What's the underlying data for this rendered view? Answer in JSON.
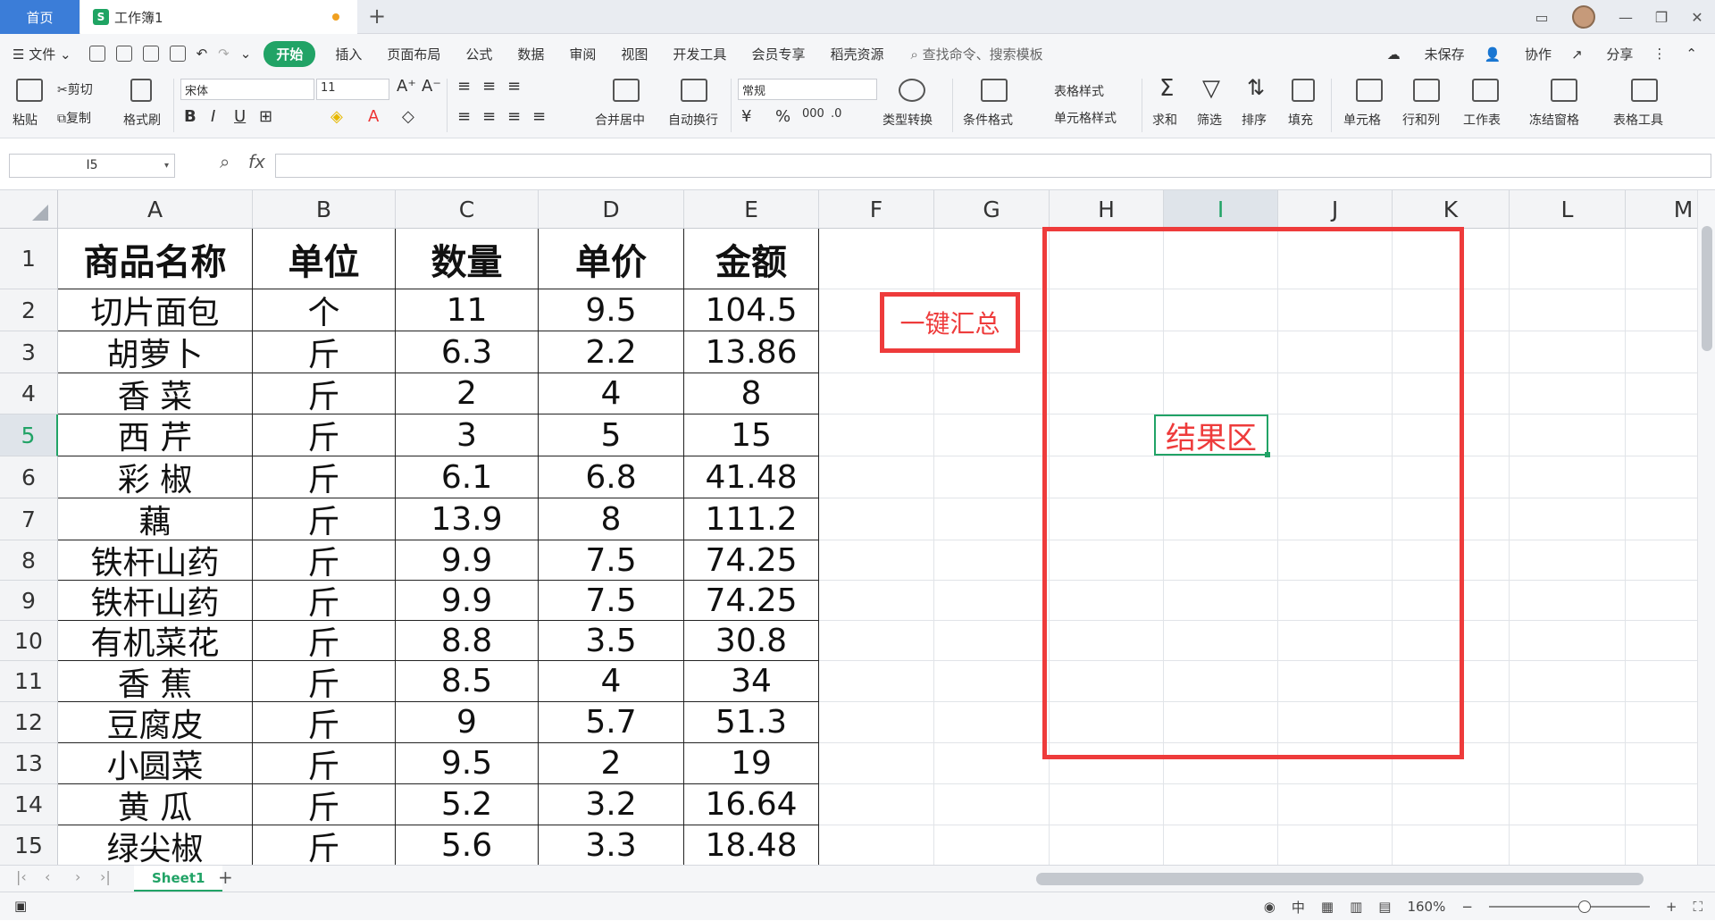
{
  "tabs": {
    "home": "首页",
    "doc": "工作簿1"
  },
  "menu": {
    "file": "文件",
    "items": [
      "开始",
      "插入",
      "页面布局",
      "公式",
      "数据",
      "审阅",
      "视图",
      "开发工具",
      "会员专享",
      "稻壳资源"
    ],
    "search": "查找命令、搜索模板",
    "right": [
      "未保存",
      "协作",
      "分享"
    ]
  },
  "ribbon": {
    "paste": "粘贴",
    "cut": "剪切",
    "copy": "复制",
    "format_painter": "格式刷",
    "font": "宋体",
    "size": "11",
    "merge": "合并居中",
    "wrap": "自动换行",
    "number_format": "常规",
    "convert": "类型转换",
    "cond_format": "条件格式",
    "table_style": "表格样式",
    "cell_style": "单元格样式",
    "sum": "求和",
    "filter": "筛选",
    "sort": "排序",
    "fill": "填充",
    "cell": "单元格",
    "rowcol": "行和列",
    "sheet": "工作表",
    "freeze": "冻结窗格",
    "tools": "表格工具"
  },
  "formula_bar": {
    "name_box": "I5",
    "fx": "fx",
    "value": ""
  },
  "columns": [
    "A",
    "B",
    "C",
    "D",
    "E",
    "F",
    "G",
    "H",
    "I",
    "J",
    "K",
    "L",
    "M"
  ],
  "selected_column": "I",
  "selected_row": 5,
  "rows": [
    "1",
    "2",
    "3",
    "4",
    "5",
    "6",
    "7",
    "8",
    "9",
    "10",
    "11",
    "12",
    "13",
    "14",
    "15"
  ],
  "table": {
    "headers": [
      "商品名称",
      "单位",
      "数量",
      "单价",
      "金额"
    ],
    "data": [
      [
        "切片面包",
        "个",
        "11",
        "9.5",
        "104.5"
      ],
      [
        "胡萝卜",
        "斤",
        "6.3",
        "2.2",
        "13.86"
      ],
      [
        "香  菜",
        "斤",
        "2",
        "4",
        "8"
      ],
      [
        "西  芹",
        "斤",
        "3",
        "5",
        "15"
      ],
      [
        "彩  椒",
        "斤",
        "6.1",
        "6.8",
        "41.48"
      ],
      [
        "藕",
        "斤",
        "13.9",
        "8",
        "111.2"
      ],
      [
        "铁杆山药",
        "斤",
        "9.9",
        "7.5",
        "74.25"
      ],
      [
        "铁杆山药",
        "斤",
        "9.9",
        "7.5",
        "74.25"
      ],
      [
        "有机菜花",
        "斤",
        "8.8",
        "3.5",
        "30.8"
      ],
      [
        "香  蕉",
        "斤",
        "8.5",
        "4",
        "34"
      ],
      [
        "豆腐皮",
        "斤",
        "9",
        "5.7",
        "51.3"
      ],
      [
        "小圆菜",
        "斤",
        "9.5",
        "2",
        "19"
      ],
      [
        "黄  瓜",
        "斤",
        "5.2",
        "3.2",
        "16.64"
      ],
      [
        "绿尖椒",
        "斤",
        "5.6",
        "3.3",
        "18.48"
      ]
    ]
  },
  "annotations": {
    "summary_button": "一键汇总",
    "result_area": "结果区"
  },
  "sheet_tabs": [
    "Sheet1"
  ],
  "status": {
    "zoom": "160%"
  },
  "colors": {
    "accent": "#21a366",
    "annotation_red": "#ee3b3b",
    "home_tab": "#3b7dd8"
  }
}
